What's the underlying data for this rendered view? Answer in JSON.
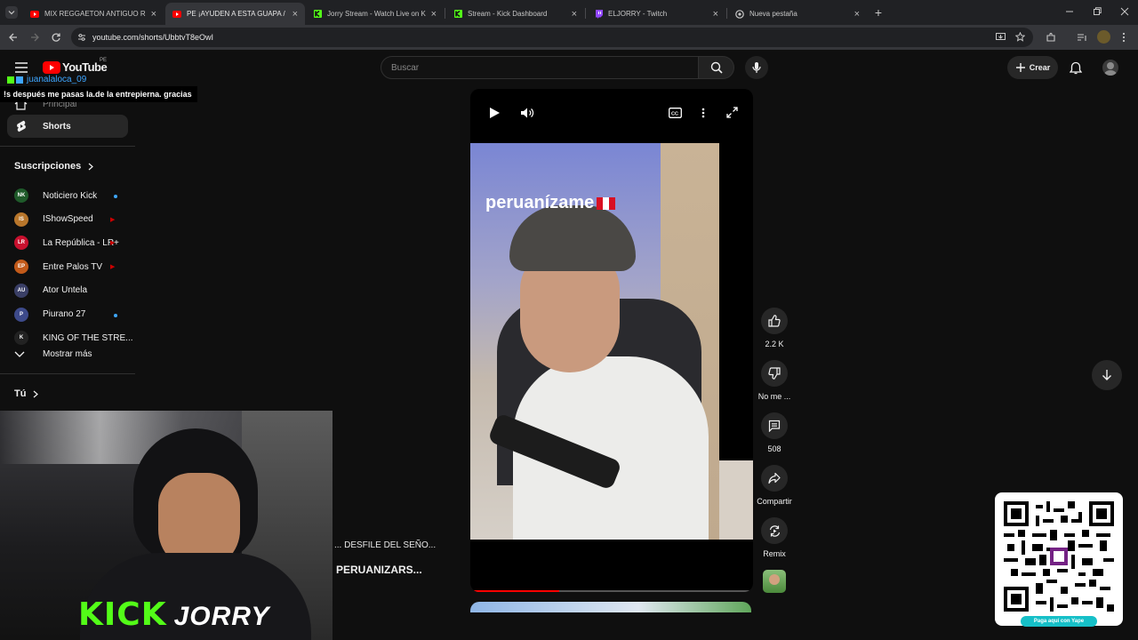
{
  "browser": {
    "tabs": [
      {
        "title": "MIX REGGAETON ANTIGUO RC",
        "favicon": "youtube-icon",
        "active": false
      },
      {
        "title": "PE ¡AYUDEN A ESTA GUAPA /",
        "favicon": "youtube-icon",
        "active": true
      },
      {
        "title": "Jorry Stream - Watch Live on Ki",
        "favicon": "kick-icon",
        "active": false
      },
      {
        "title": "Stream - Kick Dashboard",
        "favicon": "kick-icon",
        "active": false
      },
      {
        "title": "ELJORRY - Twitch",
        "favicon": "twitch-icon",
        "active": false
      },
      {
        "title": "Nueva pestaña",
        "favicon": "chrome-icon",
        "active": false
      }
    ],
    "url": "youtube.com/shorts/UbbtvT8eOwI"
  },
  "youtube": {
    "logo_text": "YouTube",
    "country": "PE",
    "search_placeholder": "Buscar",
    "create_label": "Crear",
    "nav": {
      "principal": "Principal",
      "shorts": "Shorts"
    },
    "subscriptions_title": "Suscripciones",
    "subscriptions": [
      {
        "name": "Noticiero Kick",
        "status": "dot",
        "avatar_text": "NK",
        "avatar_color": "#1f5a2a"
      },
      {
        "name": "IShowSpeed",
        "status": "live",
        "avatar_text": "IS",
        "avatar_color": "#b8762b"
      },
      {
        "name": "La República - LR+",
        "status": "live",
        "avatar_text": "LR",
        "avatar_color": "#c8102e"
      },
      {
        "name": "Entre Palos TV",
        "status": "live",
        "avatar_text": "EP",
        "avatar_color": "#c25a1a"
      },
      {
        "name": "Ator Untela",
        "status": "none",
        "avatar_text": "AU",
        "avatar_color": "#3a3f66"
      },
      {
        "name": "Piurano 27",
        "status": "dot",
        "avatar_text": "P",
        "avatar_color": "#3d4a8a"
      },
      {
        "name": "KING OF THE STRE...",
        "status": "none",
        "avatar_text": "K",
        "avatar_color": "#222222"
      }
    ],
    "show_more": "Mostrar más",
    "you_label": "Tú",
    "short": {
      "overlay_text": "peruanízame",
      "likes": "2.2 K",
      "dislike_label": "No me ...",
      "comments": "508",
      "share_label": "Compartir",
      "remix_label": "Remix",
      "progress": 0.31
    },
    "side_titles": {
      "line1": "... DESFILE DEL SEÑO...",
      "line2": "PERUANIZARS..."
    }
  },
  "stream_overlay": {
    "chat_user": "juanalaloca_09",
    "chat_message": "!s después me pasas la.de la entrepierna. gracias",
    "kick_brand": "KICK",
    "streamer_name": "JORRY",
    "qr_caption": "Paga aquí con Yape",
    "kick_color": "#53fc18"
  },
  "colors": {
    "yt_red": "#ff0000",
    "link_blue": "#3ea6ff",
    "yape_purple": "#742284"
  }
}
